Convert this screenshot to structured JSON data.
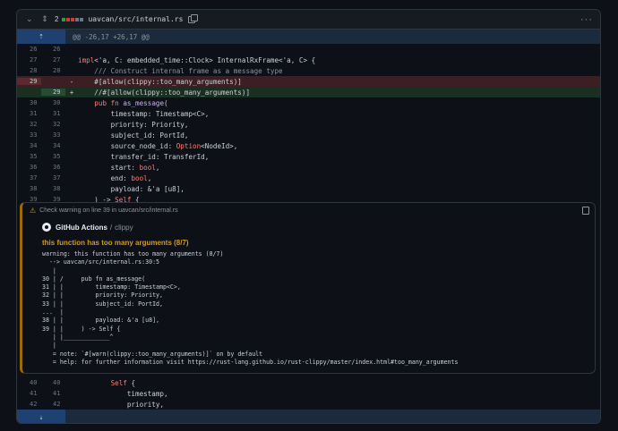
{
  "header": {
    "changes_count": "2",
    "diffstat_colors": [
      "#2ea043",
      "#da3633",
      "#da3633",
      "#6e7681",
      "#6e7681"
    ],
    "file_path": "uavcan/src/internal.rs"
  },
  "hunk": {
    "header": "@@ -26,17 +26,17 @@"
  },
  "lines": [
    {
      "old": "26",
      "new": "26",
      "marker": " ",
      "type": "ctx",
      "code": ""
    },
    {
      "old": "27",
      "new": "27",
      "marker": " ",
      "type": "ctx",
      "code": "impl<'a, C: embedded_time::Clock> InternalRxFrame<'a, C> {"
    },
    {
      "old": "28",
      "new": "28",
      "marker": " ",
      "type": "ctx",
      "code": "    /// Construct internal frame as a message type"
    },
    {
      "old": "29",
      "new": "",
      "marker": "-",
      "type": "del",
      "code": "    #[allow(clippy::too_many_arguments)]"
    },
    {
      "old": "",
      "new": "29",
      "marker": "+",
      "type": "add",
      "code": "    //#[allow(clippy::too_many_arguments)]"
    },
    {
      "old": "30",
      "new": "30",
      "marker": " ",
      "type": "ctx",
      "code": "    pub fn as_message("
    },
    {
      "old": "31",
      "new": "31",
      "marker": " ",
      "type": "ctx",
      "code": "        timestamp: Timestamp<C>,"
    },
    {
      "old": "32",
      "new": "32",
      "marker": " ",
      "type": "ctx",
      "code": "        priority: Priority,"
    },
    {
      "old": "33",
      "new": "33",
      "marker": " ",
      "type": "ctx",
      "code": "        subject_id: PortId,"
    },
    {
      "old": "34",
      "new": "34",
      "marker": " ",
      "type": "ctx",
      "code": "        source_node_id: Option<NodeId>,"
    },
    {
      "old": "35",
      "new": "35",
      "marker": " ",
      "type": "ctx",
      "code": "        transfer_id: TransferId,"
    },
    {
      "old": "36",
      "new": "36",
      "marker": " ",
      "type": "ctx",
      "code": "        start: bool,"
    },
    {
      "old": "37",
      "new": "37",
      "marker": " ",
      "type": "ctx",
      "code": "        end: bool,"
    },
    {
      "old": "38",
      "new": "38",
      "marker": " ",
      "type": "ctx",
      "code": "        payload: &'a [u8],"
    },
    {
      "old": "39",
      "new": "39",
      "marker": " ",
      "type": "ctx",
      "code": "    ) -> Self {"
    }
  ],
  "annotation": {
    "header": "Check warning on line 39 in uavcan/src/internal.rs",
    "app": "GitHub Actions",
    "separator": "/",
    "check": "clippy",
    "title": "this function has too many arguments (8/7)",
    "message": "warning: this function has too many arguments (8/7)\n  --> uavcan/src/internal.rs:30:5\n   |\n30 | /     pub fn as_message(\n31 | |         timestamp: Timestamp<C>,\n32 | |         priority: Priority,\n33 | |         subject_id: PortId,\n...  |\n38 | |         payload: &'a [u8],\n39 | |     ) -> Self {\n   | |_____________^\n   |\n   = note: `#[warn(clippy::too_many_arguments)]` on by default\n   = help: for further information visit https://rust-lang.github.io/rust-clippy/master/index.html#too_many_arguments"
  },
  "lines_after": [
    {
      "old": "40",
      "new": "40",
      "marker": " ",
      "code": "        Self {"
    },
    {
      "old": "41",
      "new": "41",
      "marker": " ",
      "code": "            timestamp,"
    },
    {
      "old": "42",
      "new": "42",
      "marker": " ",
      "code": "            priority,"
    }
  ],
  "icons": {
    "collapse": "chevron-down-icon",
    "expand": "unfold-icon",
    "copy": "copy-icon",
    "more": "kebab-horizontal-icon",
    "warning": "alert-icon",
    "github": "github-mark-icon"
  }
}
